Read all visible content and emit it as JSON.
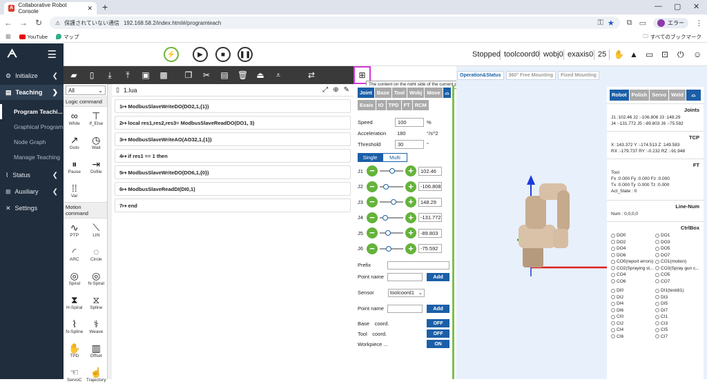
{
  "browser": {
    "tab_title": "Collaborative Robot Console",
    "security_warning": "保護されていない通信",
    "url": "192.168.58.2/index.html#/programteach",
    "profile_name": "エラー",
    "bookmarks": [
      "YouTube",
      "マップ"
    ],
    "all_bookmarks": "すべてのブックマーク"
  },
  "nav": {
    "items": [
      {
        "label": "Initialize"
      },
      {
        "label": "Teaching"
      },
      {
        "label": "Status"
      },
      {
        "label": "Auxiliary"
      },
      {
        "label": "Settings"
      }
    ],
    "sub_items": [
      "Program Teachi...",
      "Graphical Program",
      "Node Graph",
      "Manage Teaching"
    ]
  },
  "header": {
    "state": "Stopped",
    "tool": "toolcoord0",
    "wobj": "wobj0",
    "exaxis": "exaxis0",
    "speed": "25"
  },
  "tooltip": "The content on the right side of the current program pops up/hide",
  "commands": {
    "filter": "All",
    "logic_title": "Logic command",
    "logic": [
      "While",
      "If_Else",
      "Goto",
      "Wait",
      "Pause",
      "Dofile",
      "Var"
    ],
    "motion_title": "Motion command",
    "motion": [
      "PTP",
      "LIN",
      "ARC",
      "Circle",
      "Spiral",
      "N-Spiral",
      "H-Spiral",
      "Spline",
      "N-Spline",
      "Weave",
      "TPD",
      "Offset",
      "ServoC",
      "Trajectory"
    ]
  },
  "editor": {
    "file": "1.lua",
    "lines": [
      "1↦ ModbusSlaveWriteDO(DO2,1,{1})",
      "2↦ local res1,res2,res3= ModbusSlaveReadDO(DO1, 3)",
      "3↦ ModbusSlaveWriteAO(AO32,1,{1})",
      "4↦ if res1 == 1 then",
      "5↦ ModbusSlaveWriteDO(DO6,1,{0})",
      "6↦ ModbusSlaveReadDI(DI0,1)",
      "7↦ end"
    ]
  },
  "control": {
    "tabs1": [
      "Joint",
      "Base",
      "Tool",
      "Wobj",
      "Move"
    ],
    "tabs2": [
      "Exais",
      "IO",
      "TPD",
      "FT",
      "RCM"
    ],
    "speed_label": "Speed",
    "speed": "100",
    "speed_unit": "%",
    "accel_label": "Acceleration",
    "accel": "180",
    "accel_unit": "°/s^2",
    "thresh_label": "Threshold",
    "thresh": "30",
    "thresh_unit": "°",
    "mode_single": "Single",
    "mode_multi": "Multi",
    "joints": [
      {
        "name": "J1",
        "value": "102.46",
        "frac": 0.55
      },
      {
        "name": "J2",
        "value": "-106.808",
        "frac": 0.2
      },
      {
        "name": "J3",
        "value": "148.29",
        "frac": 0.6
      },
      {
        "name": "J4",
        "value": "-131.772",
        "frac": 0.15
      },
      {
        "name": "J5",
        "value": "-89.803",
        "frac": 0.3
      },
      {
        "name": "J6",
        "value": "-75.592",
        "frac": 0.35
      }
    ],
    "prefix_label": "Prefix",
    "point_label": "Point name",
    "add": "Add",
    "sensor_label": "Sensor",
    "sensor_value": "toolcoord1",
    "coords": [
      {
        "label": "Base　coord.",
        "state": "OFF"
      },
      {
        "label": "Tool　coord.",
        "state": "OFF"
      },
      {
        "label": "Workpiece ...",
        "state": "ON"
      }
    ]
  },
  "view": {
    "tabs": [
      "Operation&Status",
      "360° Free Mounting",
      "Fixed Mounting"
    ]
  },
  "info": {
    "tabs": [
      "Robot",
      "Polish",
      "Servo",
      "Weld"
    ],
    "joints_title": "Joints",
    "joints_line1": "J1 :102.46      J2 :-106.808   J3 :148.29",
    "joints_line2": "J4 :-131.772    J5 :-89.803    J6 :-75.592",
    "tcp_title": "TCP",
    "tcp_line1": "X  :143.372   Y  :-174.513   Z  :149.583",
    "tcp_line2": "RX :-179.737  RY :-0.232     RZ :-91.948",
    "ft_title": "FT",
    "ft_tool": "Tool",
    "ft_line1": "Fx :0.000      Fy :0.000      Fz :0.000",
    "ft_line2": "Tx :0.000      Ty :0.000      Tz :0.000",
    "ft_act": "Act_State  :   0",
    "linenum_title": "Line-Num",
    "linenum": "Num       :   0,0,0,0",
    "ctrlbox_title": "CtrlBox",
    "do": [
      "DO0",
      "DO1",
      "DO2",
      "DO3",
      "DO4",
      "DO5",
      "DO6",
      "DO7",
      "CO0(report errors)",
      "CO1(motion)",
      "CO2(Spraying st...",
      "CO3(Spray gun c...",
      "CO4",
      "CO5",
      "CO6",
      "CO7"
    ],
    "di": [
      "DI0",
      "DI1(testdi1)",
      "DI2",
      "DI3",
      "DI4",
      "DI5",
      "DI6",
      "DI7",
      "CI0",
      "CI1",
      "CI2",
      "CI3",
      "CI4",
      "CI5",
      "CI6",
      "CI7"
    ]
  }
}
